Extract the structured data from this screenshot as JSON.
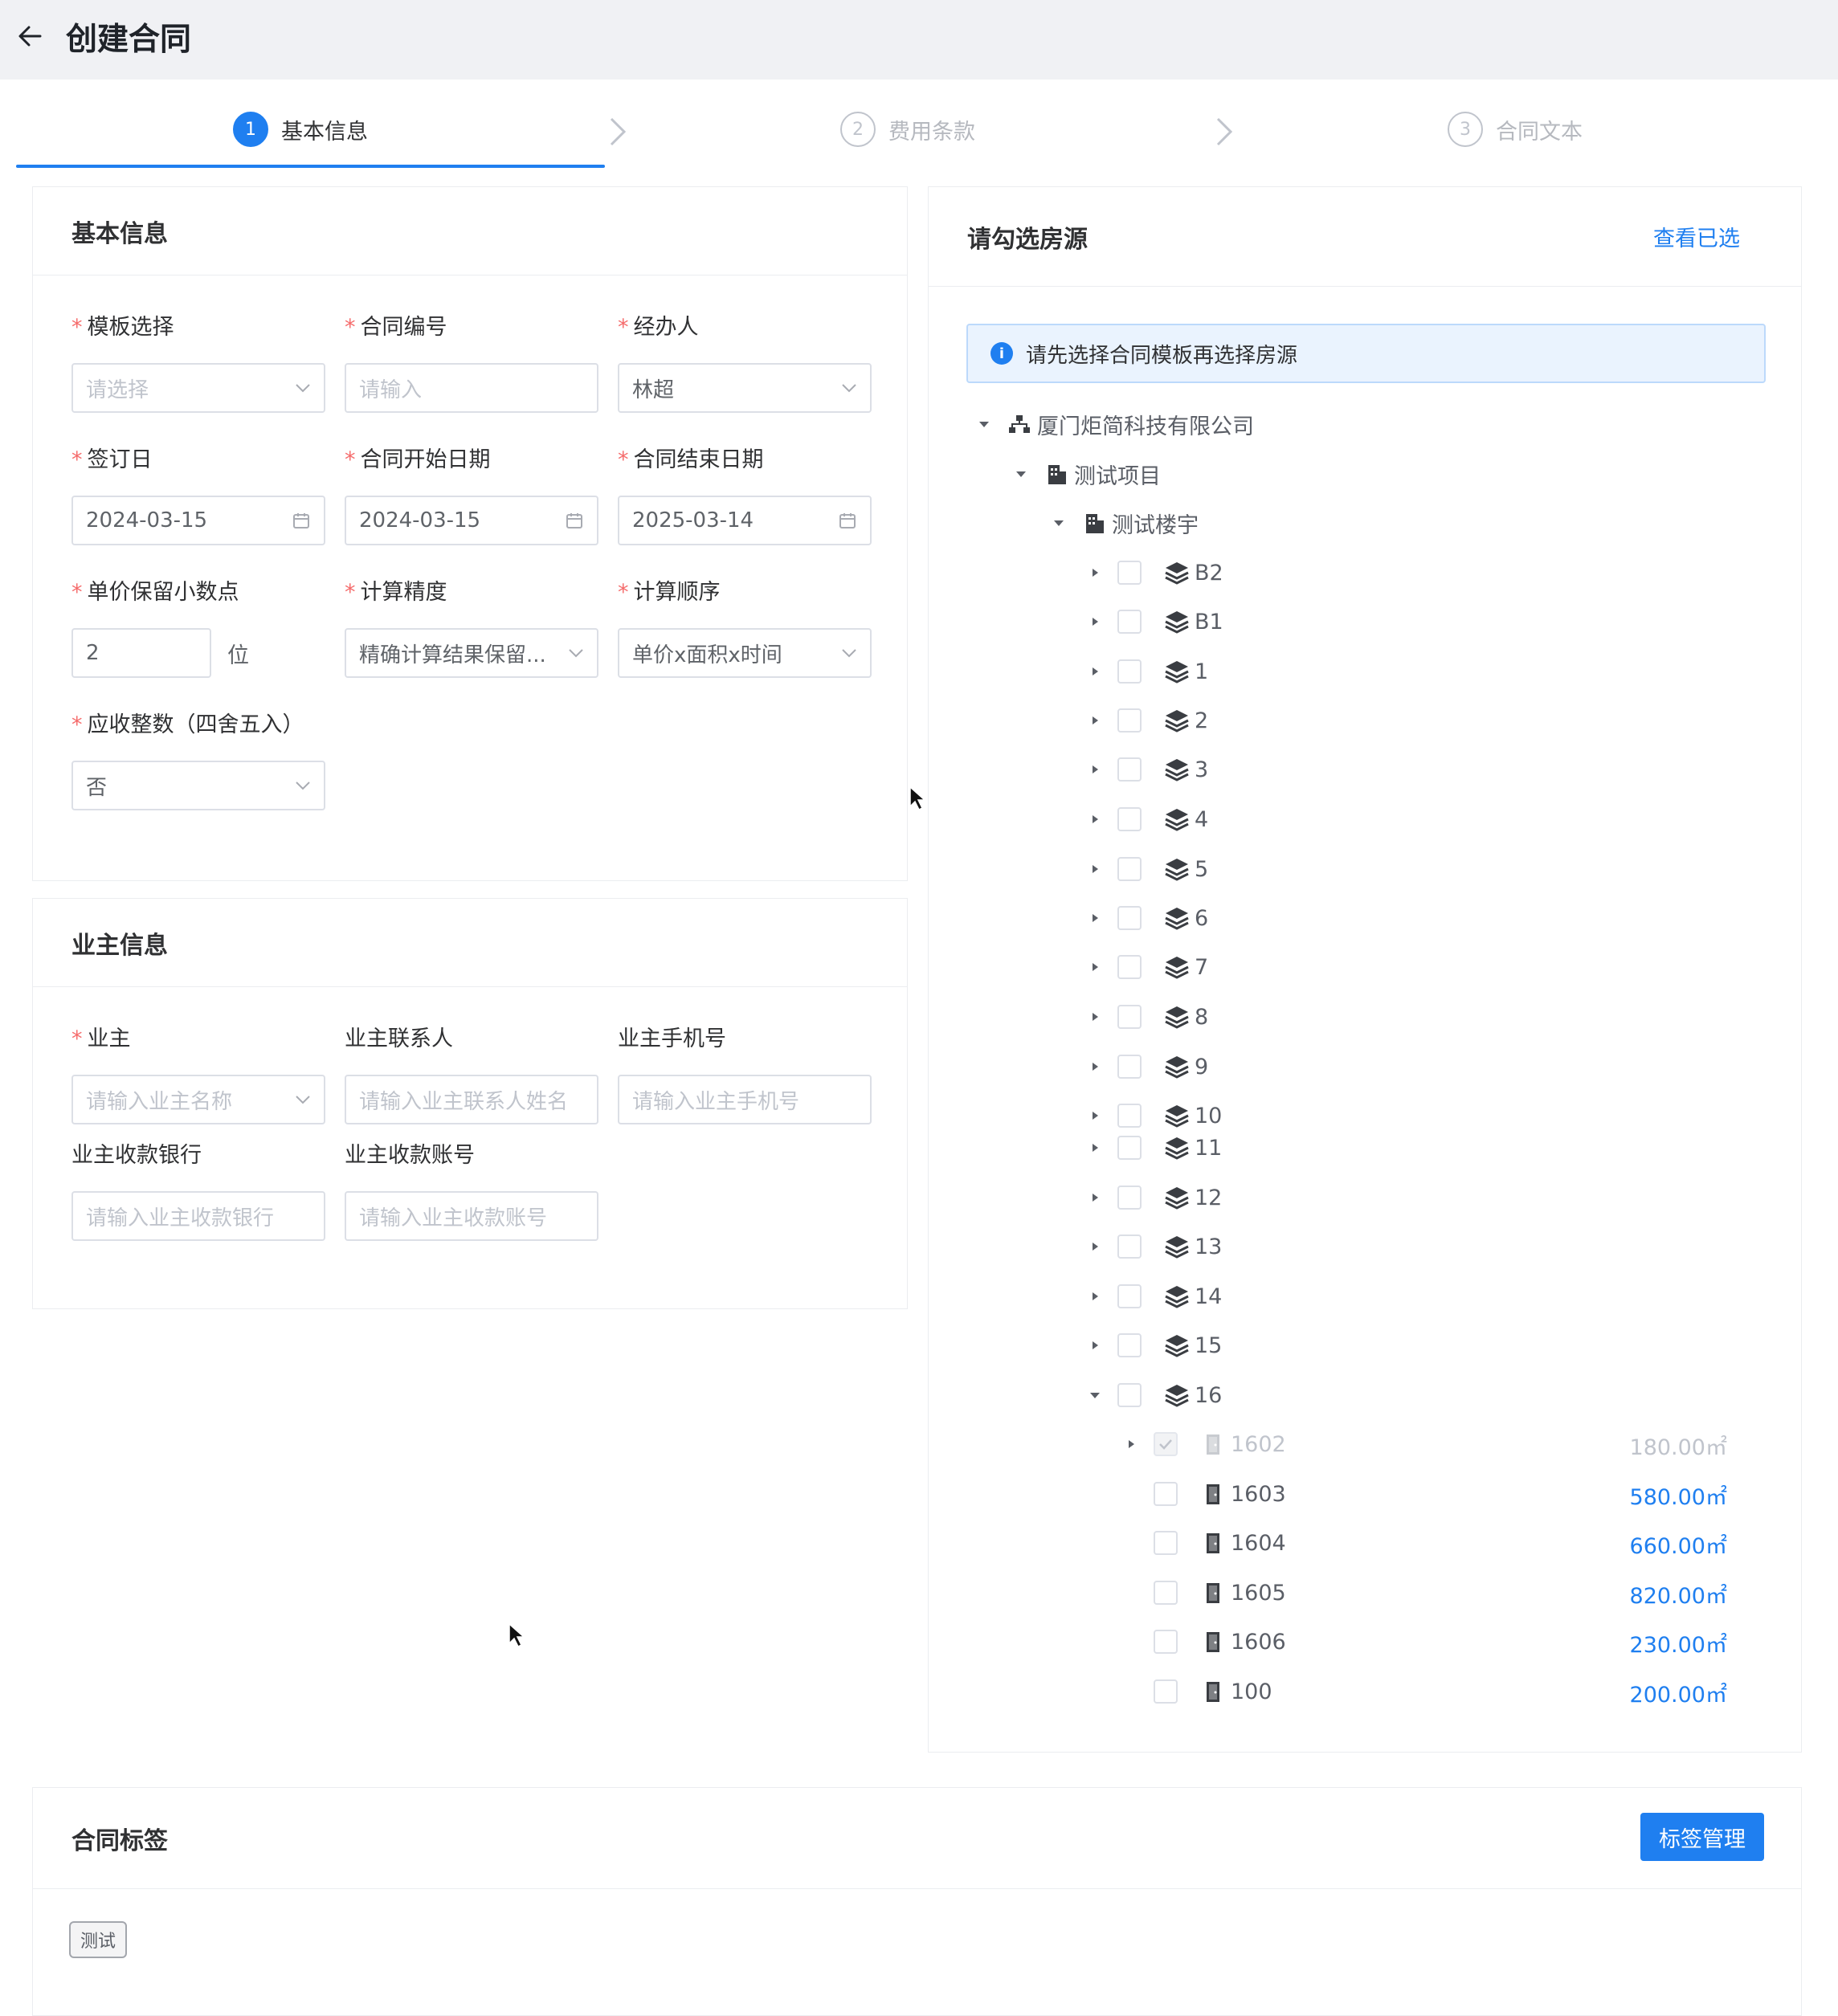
{
  "header": {
    "title": "创建合同"
  },
  "steps": [
    {
      "num": "1",
      "label": "基本信息"
    },
    {
      "num": "2",
      "label": "费用条款"
    },
    {
      "num": "3",
      "label": "合同文本"
    }
  ],
  "basic": {
    "title": "基本信息",
    "template": {
      "label": "模板选择",
      "placeholder": "请选择"
    },
    "contract_no": {
      "label": "合同编号",
      "placeholder": "请输入"
    },
    "handler": {
      "label": "经办人",
      "value": "林超"
    },
    "sign_date": {
      "label": "签订日",
      "value": "2024-03-15"
    },
    "start_date": {
      "label": "合同开始日期",
      "value": "2024-03-15"
    },
    "end_date": {
      "label": "合同结束日期",
      "value": "2025-03-14"
    },
    "decimals": {
      "label": "单价保留小数点",
      "value": "2",
      "unit": "位"
    },
    "precision": {
      "label": "计算精度",
      "value": "精确计算结果保留..."
    },
    "order": {
      "label": "计算顺序",
      "value": "单价x面积x时间"
    },
    "rounding": {
      "label": "应收整数（四舍五入）",
      "value": "否"
    }
  },
  "owner": {
    "title": "业主信息",
    "owner": {
      "label": "业主",
      "placeholder": "请输入业主名称"
    },
    "contact": {
      "label": "业主联系人",
      "placeholder": "请输入业主联系人姓名"
    },
    "phone": {
      "label": "业主手机号",
      "placeholder": "请输入业主手机号"
    },
    "bank": {
      "label": "业主收款银行",
      "placeholder": "请输入业主收款银行"
    },
    "account": {
      "label": "业主收款账号",
      "placeholder": "请输入业主收款账号"
    }
  },
  "rooms": {
    "title": "请勾选房源",
    "view_selected": "查看已选",
    "alert": "请先选择合同模板再选择房源",
    "company": "厦门炬简科技有限公司",
    "project": "测试项目",
    "building": "测试楼宇",
    "floors": [
      "B2",
      "B1",
      "1",
      "2",
      "3",
      "4",
      "5",
      "6",
      "7",
      "8",
      "9",
      "10",
      "11",
      "12",
      "13",
      "14",
      "15",
      "16"
    ],
    "units": [
      {
        "name": "1602",
        "area": "180.00㎡",
        "checked": true,
        "disabled": true
      },
      {
        "name": "1603",
        "area": "580.00㎡",
        "checked": false,
        "disabled": false
      },
      {
        "name": "1604",
        "area": "660.00㎡",
        "checked": false,
        "disabled": false
      },
      {
        "name": "1605",
        "area": "820.00㎡",
        "checked": false,
        "disabled": false
      },
      {
        "name": "1606",
        "area": "230.00㎡",
        "checked": false,
        "disabled": false
      },
      {
        "name": "100",
        "area": "200.00㎡",
        "checked": false,
        "disabled": false
      }
    ]
  },
  "tags": {
    "title": "合同标签",
    "manage_button": "标签管理",
    "items": [
      "测试"
    ]
  }
}
